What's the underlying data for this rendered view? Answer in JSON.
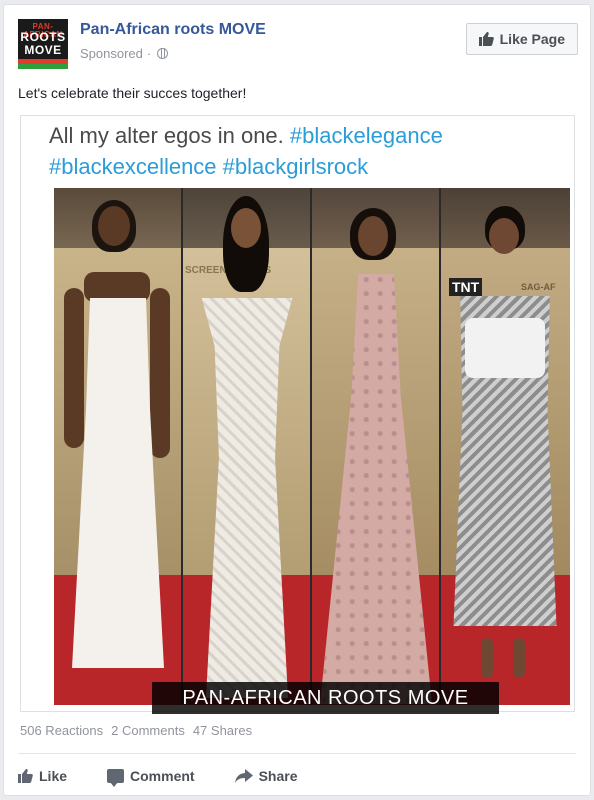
{
  "page": {
    "name": "Pan-African roots MOVE",
    "sponsored_label": "Sponsored",
    "separator": "·",
    "like_page_label": "Like Page"
  },
  "logo": {
    "line1": "PAN-AFRICAN",
    "line2": "ROOTS",
    "line3": "MOVE"
  },
  "post": {
    "text": "Let's celebrate their succes together!"
  },
  "image": {
    "caption_plain": "All my alter egos in one.",
    "caption_tags": [
      "#blackelegance",
      "#blackexcellence",
      "#blackgirlsrock"
    ],
    "watermark": "PAN-AFRICAN ROOTS MOVE",
    "backdrop_texts": [
      "SCREEN ACTORS",
      "TNT",
      "SAG-AF"
    ]
  },
  "stats": {
    "reactions": "506 Reactions",
    "comments": "2 Comments",
    "shares": "47 Shares"
  },
  "actions": {
    "like": "Like",
    "comment": "Comment",
    "share": "Share"
  },
  "colors": {
    "link_blue": "#365899",
    "hashtag_blue": "#2a9dd6",
    "muted_gray": "#90949c",
    "carpet_red": "#b9262a"
  }
}
